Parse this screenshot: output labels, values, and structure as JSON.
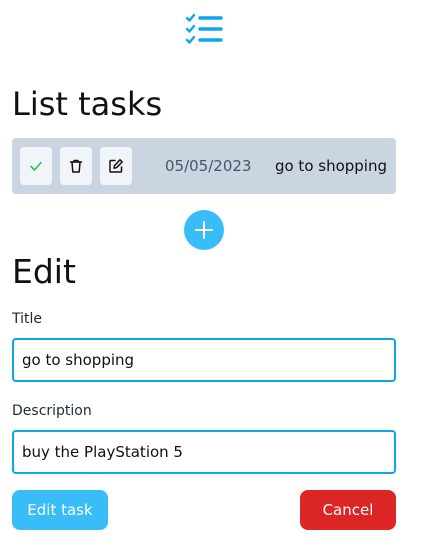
{
  "header": {
    "logo_icon": "checklist-icon",
    "accent_color": "#0ea5e9"
  },
  "list": {
    "heading": "List tasks",
    "tasks": [
      {
        "date": "05/05/2023",
        "title": "go to shopping",
        "actions": [
          "check-icon",
          "trash-icon",
          "edit-icon"
        ]
      }
    ],
    "add_icon": "plus-icon"
  },
  "edit": {
    "heading": "Edit",
    "title_label": "Title",
    "title_value": "go to shopping",
    "description_label": "Description",
    "description_value": "buy the PlayStation 5",
    "submit_label": "Edit task",
    "cancel_label": "Cancel"
  },
  "colors": {
    "row_bg": "#cbd5e1",
    "primary": "#38bdf8",
    "danger": "#dc2626",
    "check": "#22c55e"
  }
}
